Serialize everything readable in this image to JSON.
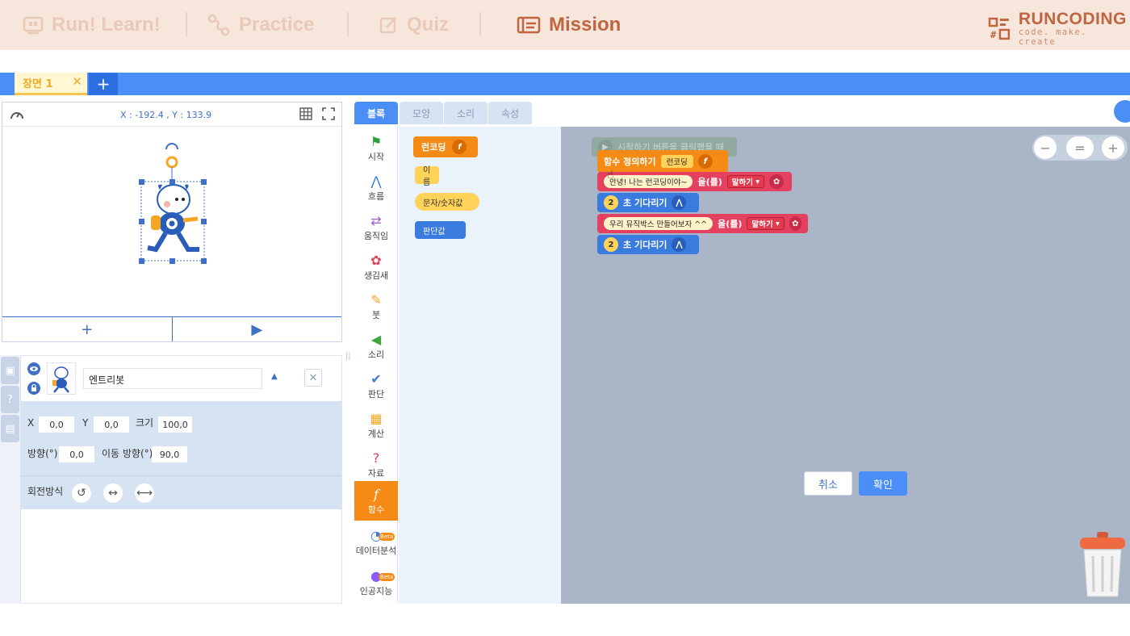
{
  "topnav": {
    "items": [
      {
        "label": "Run! Learn!",
        "icon": "monitor-icon",
        "active": false
      },
      {
        "label": "Practice",
        "icon": "path-icon",
        "active": false
      },
      {
        "label": "Quiz",
        "icon": "pencil-square-icon",
        "active": false
      },
      {
        "label": "Mission",
        "icon": "mission-icon",
        "active": true
      }
    ],
    "brand": {
      "name": "RUNCODING",
      "tagline": "code. make. create"
    }
  },
  "scenes": {
    "tab_label": "장면 1",
    "close_glyph": "✕",
    "add_glyph": "+"
  },
  "stage": {
    "coords": "X : -192.4 , Y : 133.9",
    "add_glyph": "+",
    "play_glyph": "▶"
  },
  "object": {
    "name": "엔트리봇",
    "x_label": "X",
    "x_value": "0,0",
    "y_label": "Y",
    "y_value": "0,0",
    "size_label": "크기",
    "size_value": "100,0",
    "direction_label": "방향(°)",
    "direction_value": "0,0",
    "move_direction_label": "이동 방향(°)",
    "move_direction_value": "90,0",
    "rotation_label": "회전방식"
  },
  "block_tabs": [
    "블록",
    "모양",
    "소리",
    "속성"
  ],
  "categories": [
    {
      "label": "시작",
      "icon": "flag-icon",
      "color": "#2e9d3e"
    },
    {
      "label": "흐름",
      "icon": "flow-icon",
      "color": "#3a7be0"
    },
    {
      "label": "움직임",
      "icon": "move-icon",
      "color": "#a05ad8"
    },
    {
      "label": "생김새",
      "icon": "looks-icon",
      "color": "#e4405f"
    },
    {
      "label": "붓",
      "icon": "brush-icon",
      "color": "#f5a623"
    },
    {
      "label": "소리",
      "icon": "speaker-icon",
      "color": "#3fa33f"
    },
    {
      "label": "판단",
      "icon": "check-icon",
      "color": "#3a7be0"
    },
    {
      "label": "계산",
      "icon": "calculator-icon",
      "color": "#f5a623"
    },
    {
      "label": "자료",
      "icon": "question-icon",
      "color": "#e4405f"
    },
    {
      "label": "함수",
      "icon": "function-icon",
      "color": "#ffffff"
    },
    {
      "label": "데이터분석",
      "icon": "data-analysis-icon",
      "color": "#3a7be0",
      "badge": "Beta"
    },
    {
      "label": "인공지능",
      "icon": "ai-icon",
      "color": "#8b5cf6",
      "badge": "Beta"
    }
  ],
  "palette": {
    "blocks": [
      {
        "label": "런코딩",
        "kind": "function-hat"
      },
      {
        "label": "이름",
        "kind": "name"
      },
      {
        "label": "문자/숫자값",
        "kind": "string-param"
      },
      {
        "label": "판단값",
        "kind": "boolean-param"
      }
    ]
  },
  "workspace": {
    "ghost_block": "시작하기 버튼을 클릭했을 때",
    "define_label": "함수 정의하기",
    "define_name": "런코딩",
    "say1_text": "안녕! 나는 런코딩이야~",
    "say_particle": "을(를)",
    "say_dropdown": "말하기",
    "wait1_value": "2",
    "wait_label": "초 기다리기",
    "say2_text": "우리 뮤직박스 만들어보자 ^^",
    "wait2_value": "2",
    "zoom": {
      "minus": "−",
      "reset": "=",
      "plus": "+"
    },
    "cancel_label": "취소",
    "confirm_label": "확인"
  },
  "colors": {
    "accent_blue": "#4a8ef6",
    "function_orange": "#f58a14",
    "looks_red": "#e4405f",
    "flow_blue": "#3a7be0",
    "brand": "#c0653f"
  }
}
